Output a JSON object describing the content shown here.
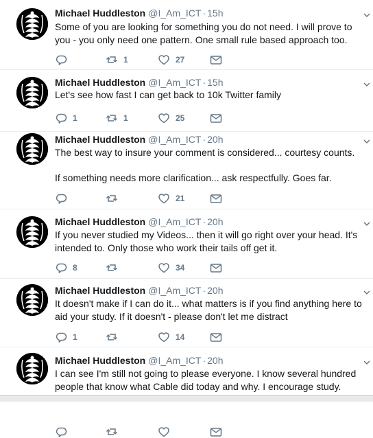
{
  "tweets": [
    {
      "name": "Michael Huddleston",
      "handle": "@I_Am_ICT",
      "dot": "·",
      "time": "15h",
      "paragraphs": [
        "Some of you are looking for something you do not need.  I will prove to you - you only need one pattern.  One small rule based approach too."
      ],
      "reply_count": "",
      "retweet_count": "1",
      "like_count": "27"
    },
    {
      "name": "Michael Huddleston",
      "handle": "@I_Am_ICT",
      "dot": "·",
      "time": "15h",
      "paragraphs": [
        "Let's see how fast I can get back to 10k Twitter family"
      ],
      "reply_count": "1",
      "retweet_count": "1",
      "like_count": "25"
    },
    {
      "name": "Michael Huddleston",
      "handle": "@I_Am_ICT",
      "dot": "·",
      "time": "20h",
      "paragraphs": [
        "The best way to insure your comment is considered... courtesy counts.",
        "If something needs more clarification... ask respectfully.  Goes far."
      ],
      "reply_count": "",
      "retweet_count": "",
      "like_count": "21"
    },
    {
      "name": "Michael Huddleston",
      "handle": "@I_Am_ICT",
      "dot": "·",
      "time": "20h",
      "paragraphs": [
        "If you never studied my Videos... then it will go right over your head.  It's intended to.  Only those who work their tails off get it."
      ],
      "reply_count": "8",
      "retweet_count": "",
      "like_count": "34"
    },
    {
      "name": "Michael Huddleston",
      "handle": "@I_Am_ICT",
      "dot": "·",
      "time": "20h",
      "paragraphs": [
        "It doesn't make if I can do it... what matters is if you find anything here to aid your study.  If it doesn't - please don't let me distract"
      ],
      "reply_count": "1",
      "retweet_count": "",
      "like_count": "14"
    },
    {
      "name": "Michael Huddleston",
      "handle": "@I_Am_ICT",
      "dot": "·",
      "time": "20h",
      "paragraphs": [
        "I can see I'm still not going to please everyone.  I know several hundred people that know what Cable did today and why.  I encourage study."
      ],
      "reply_count": "",
      "retweet_count": "",
      "like_count": ""
    }
  ],
  "icons": {
    "reply": "reply-icon",
    "retweet": "retweet-icon",
    "like": "heart-icon",
    "message": "envelope-icon",
    "caret": "chevron-down-icon"
  },
  "colors": {
    "text": "#14171a",
    "secondary": "#657786",
    "icon": "#657786",
    "divider": "#e6ecf0"
  }
}
